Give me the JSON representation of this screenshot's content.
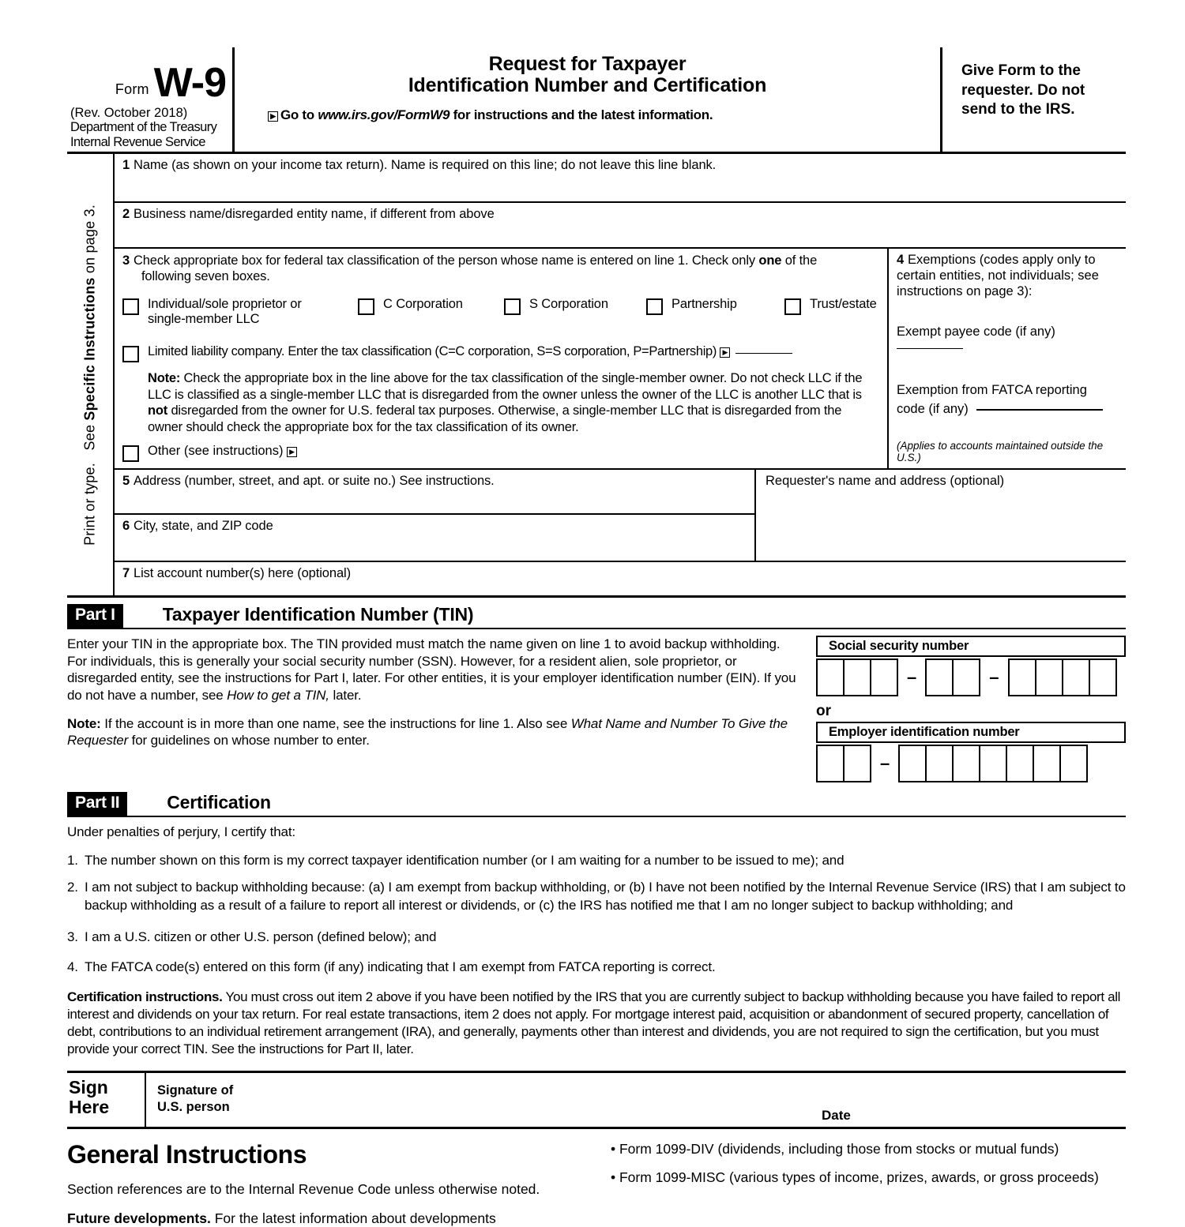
{
  "header": {
    "form_word": "Form",
    "form_number": "W-9",
    "revision": "(Rev. October 2018)",
    "dept_line1": "Department of the Treasury",
    "dept_line2": "Internal Revenue Service",
    "title_line1": "Request for Taxpayer",
    "title_line2": "Identification Number and Certification",
    "goto_prefix": "Go to ",
    "goto_url": "www.irs.gov/FormW9",
    "goto_suffix": " for instructions and the latest information.",
    "give_form_note": "Give Form to the requester. Do not send to the IRS."
  },
  "sidebar": {
    "line_a": "Print or type.",
    "line_b_pre": "See ",
    "line_b_bold": "Specific Instructions",
    "line_b_post": " on page 3."
  },
  "fields": {
    "line1_num": "1",
    "line1_label": "Name (as shown on your income tax return). Name is required on this line; do not leave this line blank.",
    "line2_num": "2",
    "line2_label": "Business name/disregarded entity name, if different from above",
    "line3_num": "3",
    "line3_label_a": "Check appropriate box for federal tax classification of the person whose name is entered on line 1. Check only ",
    "line3_bold": "one",
    "line3_label_b": " of the",
    "line3_label_c": "following seven boxes.",
    "classifications": [
      {
        "label_line1": "Individual/sole proprietor or",
        "label_line2": "single-member LLC"
      },
      {
        "label_line1": "C Corporation",
        "label_line2": ""
      },
      {
        "label_line1": "S Corporation",
        "label_line2": ""
      },
      {
        "label_line1": "Partnership",
        "label_line2": ""
      },
      {
        "label_line1": "Trust/estate",
        "label_line2": ""
      }
    ],
    "llc_label": "Limited liability company. Enter the tax classification (C=C corporation, S=S corporation, P=Partnership)",
    "note_bold": "Note:",
    "note_text_1": " Check the appropriate box in the line above for the tax classification of the single-member owner. Do not check LLC if the LLC is classified as a single-member LLC that is disregarded from the owner unless the owner of the LLC is another LLC that is ",
    "note_bold_2": "not",
    "note_text_2": " disregarded from the owner for U.S. federal tax purposes. Otherwise, a single-member LLC that is disregarded from the owner should check the appropriate box for the tax classification of its owner.",
    "other_label": "Other (see instructions)",
    "line4_num": "4",
    "line4_label": "Exemptions (codes apply only to certain entities, not individuals; see instructions on page 3):",
    "exempt_payee_label": "Exempt payee code (if any)",
    "fatca_label_1": "Exemption from FATCA reporting",
    "fatca_label_2": "code (if any)",
    "applies_note": "(Applies to accounts maintained outside the U.S.)",
    "line5_num": "5",
    "line5_label": "Address (number, street, and apt. or suite no.) See instructions.",
    "line6_num": "6",
    "line6_label": "City, state, and ZIP code",
    "line7_num": "7",
    "line7_label": "List account number(s) here (optional)",
    "requester_label": "Requester's name and address (optional)"
  },
  "part1": {
    "tag": "Part I",
    "title": "Taxpayer Identification Number (TIN)",
    "para1_a": "Enter your TIN in the appropriate box. The TIN provided must match the name given on line 1 to avoid backup withholding. For individuals, this is generally your social security number (SSN). However, for a resident alien, sole proprietor, or disregarded entity, see the instructions for Part I, later. For other entities, it is your employer identification number (EIN). If you do not have a number, see ",
    "para1_italic": "How to get a TIN,",
    "para1_b": " later.",
    "note_bold": "Note:",
    "para2_a": " If the account is in more than one name, see the instructions for line 1. Also see ",
    "para2_italic": "What Name and Number To Give the Requester",
    "para2_b": " for guidelines on whose number to enter.",
    "ssn_label": "Social security number",
    "ssn_groups": [
      3,
      2,
      4
    ],
    "or_label": "or",
    "ein_label": "Employer identification number",
    "ein_groups": [
      2,
      7
    ]
  },
  "part2": {
    "tag": "Part II",
    "title": "Certification",
    "intro": "Under penalties of perjury, I certify that:",
    "items": [
      {
        "n": "1.",
        "text": "The number shown on this form is my correct taxpayer identification number (or I am waiting for a number to be issued to me);  and"
      },
      {
        "n": "2.",
        "text": "I am not subject to backup withholding because: (a) I am exempt from backup withholding, or (b) I have not been notified by the Internal Revenue Service (IRS) that I am subject to backup withholding as a result of a failure to report all interest or dividends, or (c) the IRS has notified me that I am no longer subject to backup withholding; and"
      },
      {
        "n": "3.",
        "text": "I am a U.S. citizen or other U.S. person (defined below); and"
      },
      {
        "n": "4.",
        "text": "The FATCA code(s) entered on this form (if any) indicating that I am exempt from FATCA reporting is correct."
      }
    ],
    "cert_instr_bold": "Certification instructions.",
    "cert_instr_text": " You must cross out item 2 above if you have been notified by the IRS that you are currently subject to backup withholding because you have failed to report all interest and dividends on your tax return. For real estate transactions, item 2 does not apply. For mortgage interest paid, acquisition or abandonment of secured property, cancellation of debt, contributions to an individual retirement arrangement (IRA), and generally, payments other than interest and dividends, you are not required to sign the certification, but you must provide your correct TIN. See the instructions for Part II, later."
  },
  "sign": {
    "sign_line1": "Sign",
    "sign_line2": "Here",
    "signature_line1": "Signature of",
    "signature_line2": "U.S. person",
    "date_label": "Date"
  },
  "general_instructions": {
    "title": "General Instructions",
    "para1": "Section references are to the Internal Revenue Code unless otherwise noted.",
    "future_bold": "Future developments.",
    "future_text": " For the latest information about developments",
    "bullets": [
      "• Form 1099-DIV (dividends, including those from stocks or mutual funds)",
      "• Form 1099-MISC (various types of income, prizes, awards, or gross proceeds)"
    ]
  }
}
